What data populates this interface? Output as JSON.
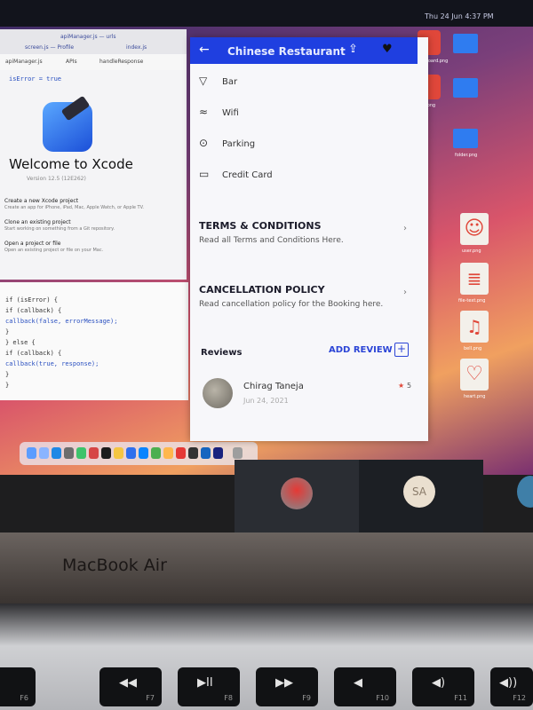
{
  "menubar": {
    "right_text": "Thu 24 Jun 4:37 PM"
  },
  "xcode": {
    "tabs": [
      "apiManager.js — urls",
      "screen.js — Profile",
      "index.js"
    ],
    "breadcrumb": [
      "apiManager.js",
      "APIs",
      "handleResponse"
    ],
    "code_top": "isError = true",
    "welcome_title": "Welcome to Xcode",
    "version": "Version 12.5 (12E262)",
    "items": [
      {
        "title": "Create a new Xcode project",
        "desc": "Create an app for iPhone, iPad, Mac, Apple Watch, or Apple TV."
      },
      {
        "title": "Clone an existing project",
        "desc": "Start working on something from a Git repository."
      },
      {
        "title": "Open a project or file",
        "desc": "Open an existing project or file on your Mac."
      }
    ]
  },
  "code": {
    "lines": [
      "if (isError) {",
      "  if (callback) {",
      "    callback(false, errorMessage);",
      "  }",
      "} else {",
      "  if (callback) {",
      "    callback(true, response);",
      "  }",
      "}"
    ]
  },
  "desktop_icons": [
    {
      "label": "clipboard.png",
      "icon": "clipboard-icon"
    },
    {
      "label": "tick.png",
      "icon": "tick-icon"
    },
    {
      "label": "folder.png",
      "icon": "folder-icon"
    },
    {
      "label": "user.png",
      "icon": "user-icon"
    },
    {
      "label": "file-text.png",
      "icon": "file-text-icon"
    },
    {
      "label": "bell.png",
      "icon": "bell-icon"
    },
    {
      "label": "heart.png",
      "icon": "heart-icon"
    }
  ],
  "phone": {
    "title": "Chinese Restaurant",
    "amenities": [
      {
        "label": "Bar",
        "icon": "glass-icon"
      },
      {
        "label": "Wifi",
        "icon": "wifi-icon"
      },
      {
        "label": "Parking",
        "icon": "pin-icon"
      },
      {
        "label": "Credit Card",
        "icon": "card-icon"
      }
    ],
    "terms": {
      "title": "TERMS & CONDITIONS",
      "desc": "Read all Terms and Conditions Here."
    },
    "cancellation": {
      "title": "CANCELLATION POLICY",
      "desc": "Read cancellation policy for the Booking here."
    },
    "reviews": {
      "title": "Reviews",
      "add_label": "ADD REVIEW",
      "items": [
        {
          "name": "Chirag Taneja",
          "date": "Jun 24, 2021",
          "rating": "5"
        }
      ]
    }
  },
  "call": {
    "initials": "SA"
  },
  "laptop": {
    "model": "MacBook Air"
  },
  "keys": [
    {
      "fn": "F6",
      "sym": "☾"
    },
    {
      "fn": "F7",
      "sym": "◀◀"
    },
    {
      "fn": "F8",
      "sym": "▶II"
    },
    {
      "fn": "F9",
      "sym": "▶▶"
    },
    {
      "fn": "F10",
      "sym": "◀"
    },
    {
      "fn": "F11",
      "sym": "◀)"
    },
    {
      "fn": "F12",
      "sym": "◀))"
    }
  ],
  "colors": {
    "header_blue": "#1f3fe0",
    "accent_blue": "#2c45d6",
    "star_red": "#e0483a"
  }
}
